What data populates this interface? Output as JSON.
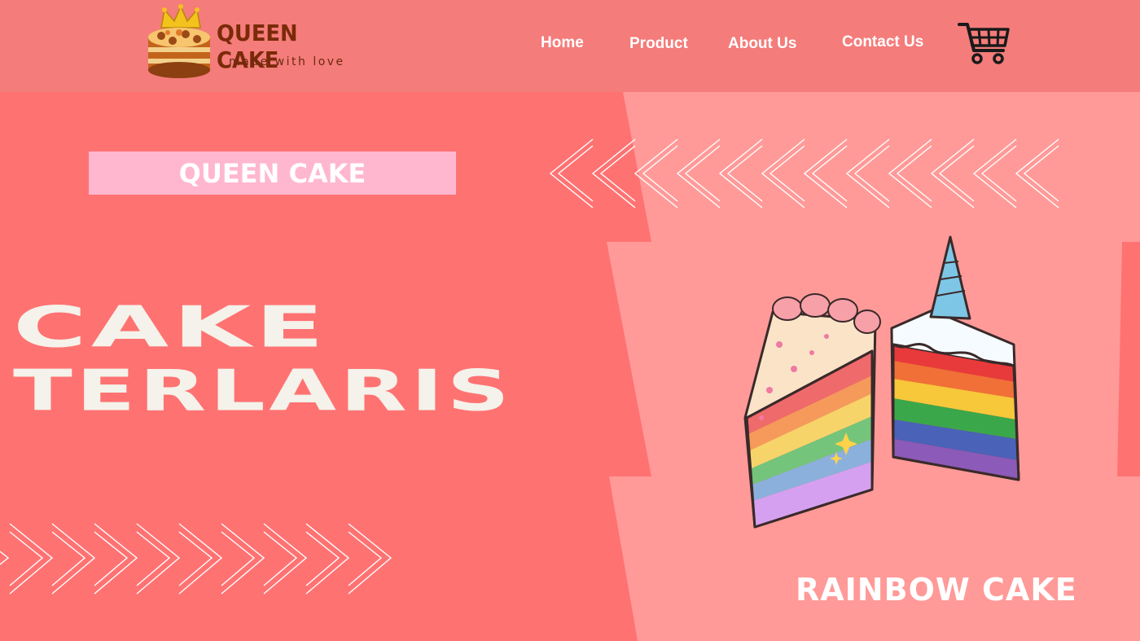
{
  "brand": {
    "name": "QUEEN CAKE",
    "tagline": "made with love"
  },
  "nav": {
    "items": [
      "Home",
      "Product",
      "About Us",
      "Contact Us"
    ]
  },
  "cart": {
    "icon": "shopping-cart-icon"
  },
  "hero": {
    "badge": "QUEEN CAKE",
    "headline_line1": "CAKE",
    "headline_line2": "TERLARIS",
    "caption": "RAINBOW CAKE"
  },
  "colors": {
    "header_bg": "#f47c7a",
    "hero_bg": "#ff7272",
    "panel": "#ff9a98",
    "badge_bg": "#ffb7cf",
    "headline": "#f4f2ea"
  }
}
